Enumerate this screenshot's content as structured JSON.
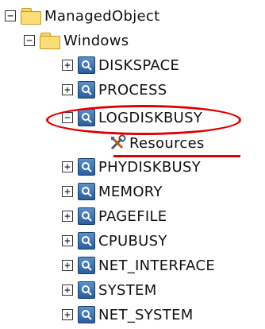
{
  "tree": {
    "root": {
      "label": "ManagedObject",
      "expander": "−"
    },
    "windows": {
      "label": "Windows",
      "expander": "−"
    },
    "items": [
      {
        "label": "DISKSPACE",
        "expander": "+"
      },
      {
        "label": "PROCESS",
        "expander": "+"
      },
      {
        "label": "LOGDISKBUSY",
        "expander": "−"
      },
      {
        "label": "PHYDISKBUSY",
        "expander": "+"
      },
      {
        "label": "MEMORY",
        "expander": "+"
      },
      {
        "label": "PAGEFILE",
        "expander": "+"
      },
      {
        "label": "CPUBUSY",
        "expander": "+"
      },
      {
        "label": "NET_INTERFACE",
        "expander": "+"
      },
      {
        "label": "SYSTEM",
        "expander": "+"
      },
      {
        "label": "NET_SYSTEM",
        "expander": "+"
      }
    ],
    "resources": {
      "label": "Resources"
    }
  },
  "colors": {
    "highlight": "#e00000",
    "folder": "#fbdd78",
    "monitor_icon": "#2b5e9a"
  },
  "icons": {
    "folder": "folder-icon",
    "monitor": "monitor-icon",
    "resources": "tools-icon"
  }
}
